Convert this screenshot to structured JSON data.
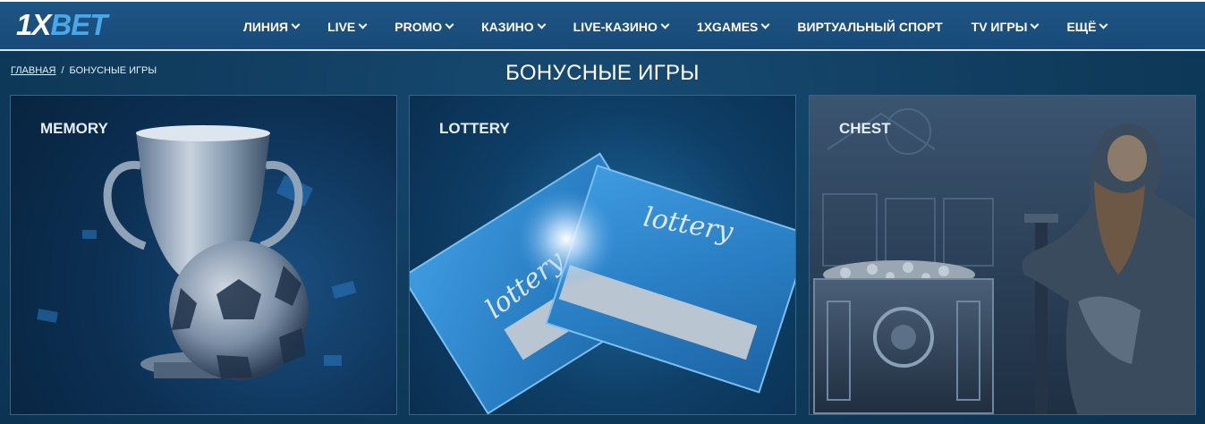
{
  "header": {
    "logo": {
      "part1": "1X",
      "part2": "BET"
    },
    "nav": [
      {
        "label": "ЛИНИЯ",
        "has_dropdown": true
      },
      {
        "label": "LIVE",
        "has_dropdown": true
      },
      {
        "label": "PROMO",
        "has_dropdown": true
      },
      {
        "label": "КАЗИНО",
        "has_dropdown": true
      },
      {
        "label": "LIVE-КАЗИНО",
        "has_dropdown": true
      },
      {
        "label": "1XGAMES",
        "has_dropdown": true
      },
      {
        "label": "ВИРТУАЛЬНЫЙ СПОРТ",
        "has_dropdown": false
      },
      {
        "label": "TV ИГРЫ",
        "has_dropdown": true
      },
      {
        "label": "ЕЩЁ",
        "has_dropdown": true
      }
    ]
  },
  "breadcrumb": {
    "home": "ГЛАВНАЯ",
    "separator": "/",
    "current": "БОНУСНЫЕ ИГРЫ"
  },
  "page_title": "БОНУСНЫЕ ИГРЫ",
  "games": [
    {
      "title": "MEMORY",
      "image": "trophy-and-football"
    },
    {
      "title": "LOTTERY",
      "image": "lottery-tickets",
      "ticket_text": "lottery"
    },
    {
      "title": "CHEST",
      "image": "viking-and-treasure-chest"
    }
  ],
  "colors": {
    "header_bg": "#1b4f7e",
    "page_bg": "#0e3a5c",
    "logo_accent": "#4aa8e8",
    "text": "#ffffff"
  }
}
